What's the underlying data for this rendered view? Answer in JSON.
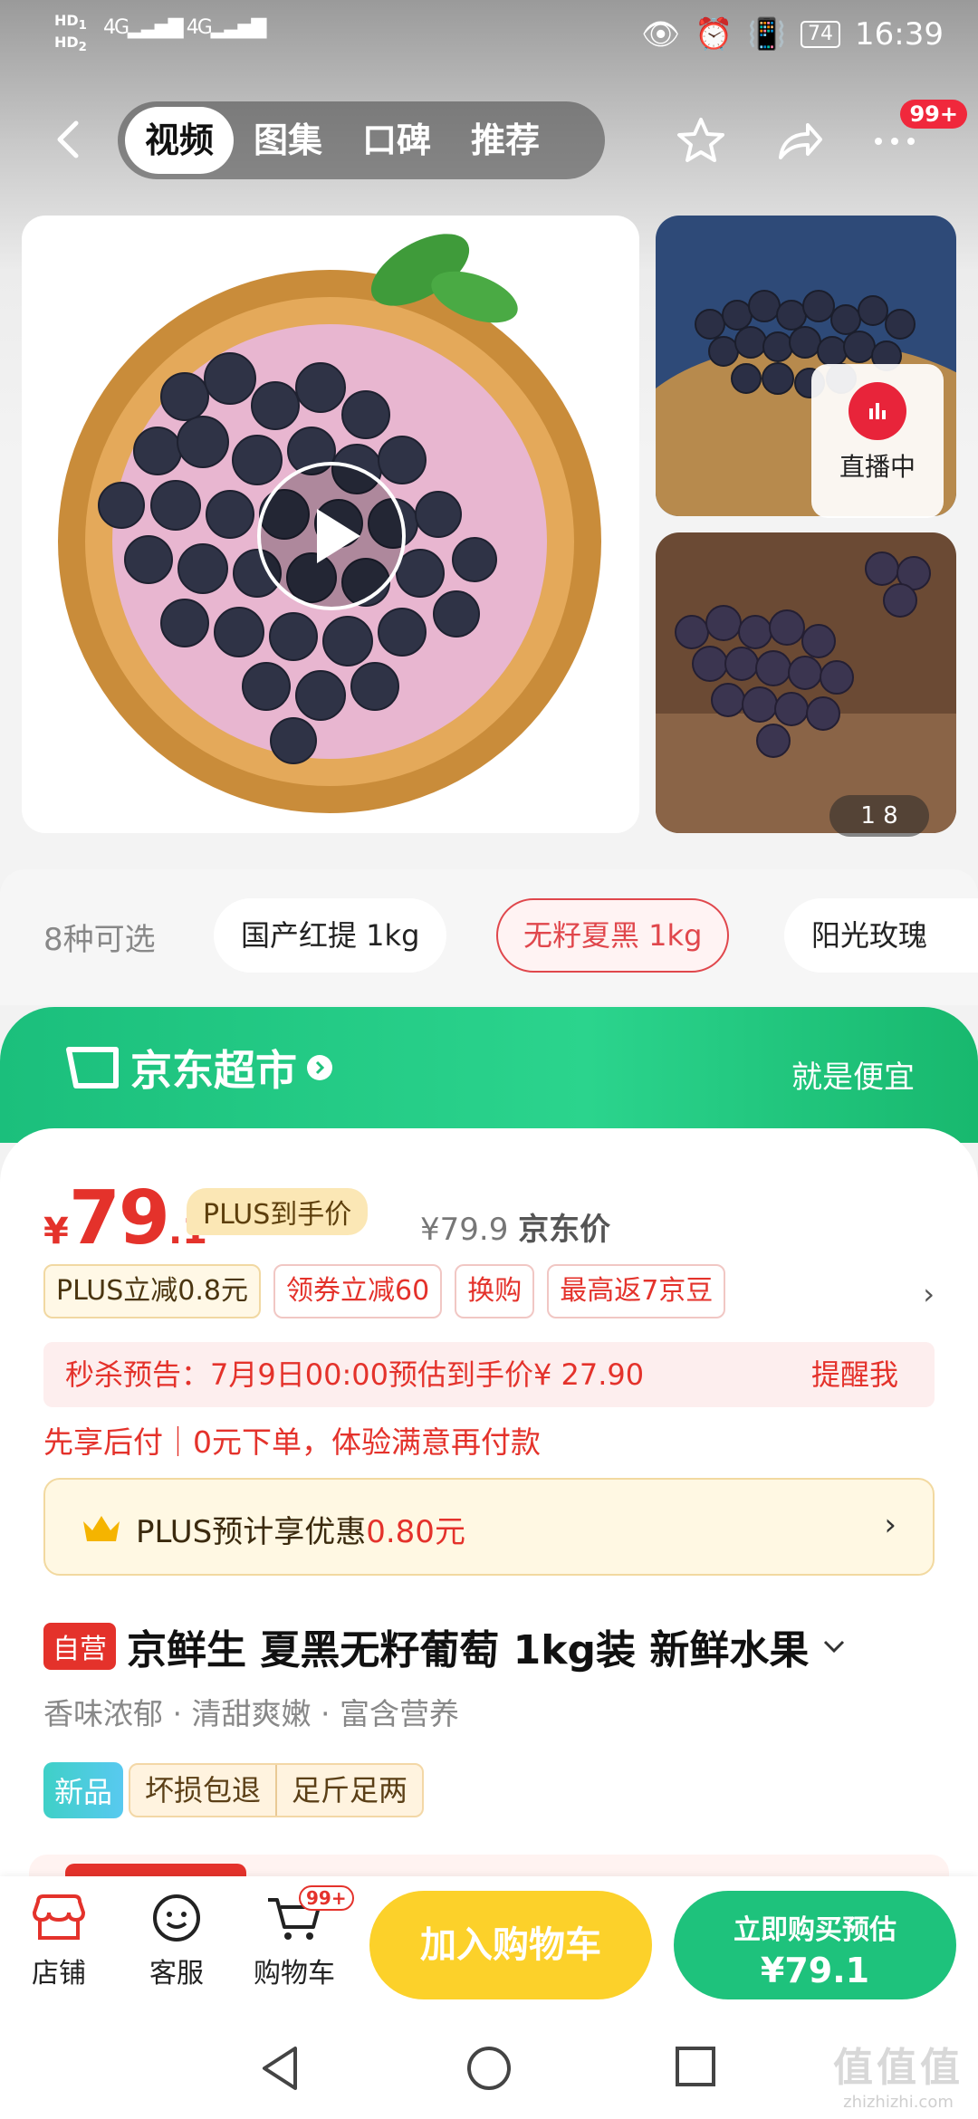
{
  "status_bar": {
    "signal_left": "HD 1 HD 2",
    "net1": "4G",
    "net2": "4G",
    "battery": "74",
    "time": "16:39"
  },
  "nav": {
    "tabs": [
      "视频",
      "图集",
      "口碑",
      "推荐"
    ],
    "active_tab": 0,
    "more_badge": "99+"
  },
  "gallery": {
    "live_label": "直播中",
    "counter": "1 8"
  },
  "variants": {
    "label": "8种可选",
    "options": [
      "国产红提 1kg",
      "无籽夏黑 1kg",
      "阳光玫瑰"
    ],
    "selected": 1
  },
  "store_banner": {
    "name": "京东超市",
    "slogan": "就是便宜"
  },
  "pricing": {
    "yen": "¥",
    "int": "79",
    "dec": ".1",
    "plus_label": "PLUS到手价",
    "jd_price": "¥79.9",
    "jd_price_label": "京东价"
  },
  "promos": [
    "PLUS立减0.8元",
    "领券立减60",
    "换购",
    "最高返7京豆"
  ],
  "seckill": {
    "text": "秒杀预告：7月9日00:00预估到手价¥ 27.90",
    "remind": "提醒我"
  },
  "paylater": "先享后付｜0元下单，体验满意再付款",
  "plus_box": {
    "text_a": "PLUS预计享优惠",
    "text_b": "0.80元"
  },
  "product": {
    "self_tag": "自营",
    "title": "京鲜生 夏黑无籽葡萄 1kg装 新鲜水果",
    "features": "香味浓郁 · 清甜爽嫩 · 富含营养"
  },
  "tags": {
    "new": "新品",
    "pair": [
      "坏损包退",
      "足斤足两"
    ]
  },
  "bottom_bar": {
    "shop": "店铺",
    "service": "客服",
    "cart": "购物车",
    "cart_badge": "99+",
    "add_cart": "加入购物车",
    "buy_line1": "立即购买预估",
    "buy_line2": "¥79.1"
  },
  "watermark": {
    "big": "值值值",
    "small": "zhizhizhi.com"
  },
  "colors": {
    "price_red": "#e4322b",
    "jd_green": "#1ec27c",
    "cart_yellow": "#fcd12a"
  }
}
